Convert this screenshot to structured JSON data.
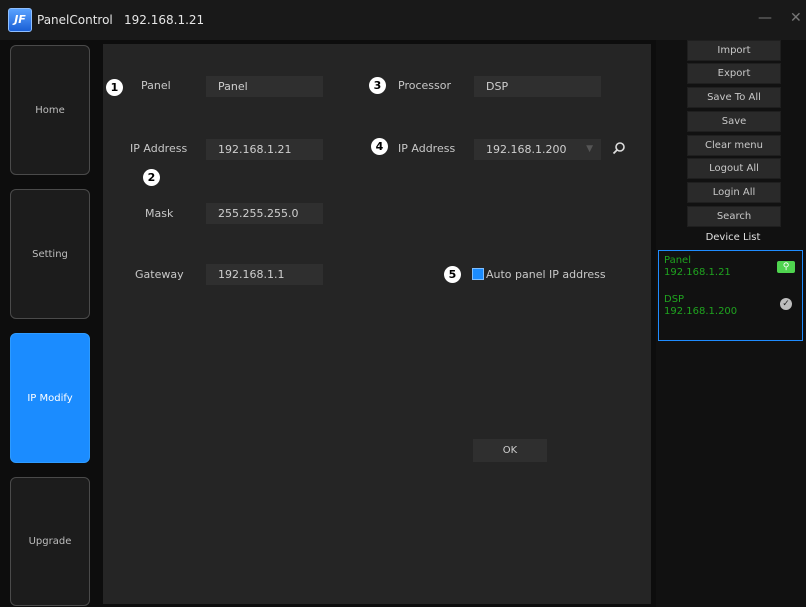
{
  "window": {
    "app_name": "PanelControl",
    "ip": "192.168.1.21",
    "logo_text": "JF",
    "minimize": "—",
    "close": "✕"
  },
  "nav": [
    {
      "label": "Home"
    },
    {
      "label": "Setting"
    },
    {
      "label": "IP Modify"
    },
    {
      "label": "Upgrade"
    }
  ],
  "nav_active": "IP Modify",
  "main": {
    "markers": [
      "1",
      "2",
      "3",
      "4",
      "5"
    ],
    "panel_label": "Panel",
    "panel_value": "Panel",
    "ip_label": "IP Address",
    "ip_value": "192.168.1.21",
    "mask_label": "Mask",
    "mask_value": "255.255.255.0",
    "gateway_label": "Gateway",
    "gateway_value": "192.168.1.1",
    "processor_label": "Processor",
    "processor_value": "DSP",
    "proc_ip_label": "IP Address",
    "proc_ip_value": "192.168.1.200",
    "dropdown_icon": "▼",
    "auto_ip_label": "Auto panel IP address",
    "auto_ip_checked": true,
    "ok_label": "OK"
  },
  "sidebar": {
    "buttons": [
      "Import",
      "Export",
      "Save To All",
      "Save",
      "Clear menu",
      "Logout All",
      "Login All",
      "Search"
    ],
    "device_list_title": "Device List",
    "devices": [
      {
        "name": "Panel",
        "ip": "192.168.1.21"
      },
      {
        "name": "DSP",
        "ip": "192.168.1.200"
      }
    ]
  },
  "colors": {
    "accent": "#1b8cff",
    "device_text": "#1fa31f",
    "background": "#252525"
  }
}
